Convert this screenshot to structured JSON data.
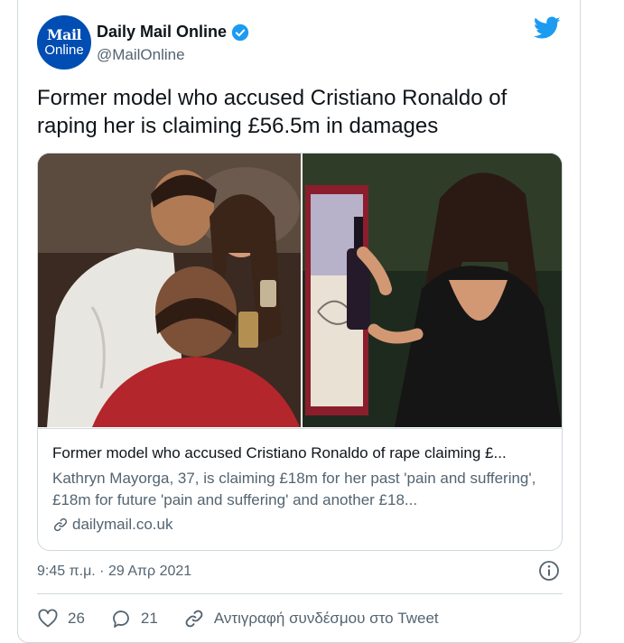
{
  "account": {
    "avatar_line1": "Mail",
    "avatar_line2": "Online",
    "display_name": "Daily Mail Online",
    "handle": "@MailOnline",
    "verified": true
  },
  "tweet": {
    "text": "Former model who accused Cristiano Ronaldo of raping her is claiming £56.5m in damages"
  },
  "card": {
    "title": "Former model who accused Cristiano Ronaldo of rape claiming £...",
    "description": "Kathryn Mayorga, 37, is claiming £18m for her past 'pain and suffering', £18m for future 'pain and suffering' and another £18...",
    "domain": "dailymail.co.uk",
    "media_description": "photo"
  },
  "meta": {
    "timestamp": "9:45 π.μ. · 29 Απρ 2021"
  },
  "actions": {
    "likes": "26",
    "replies": "21",
    "copy_link_label": "Αντιγραφή συνδέσμου στο Tweet"
  },
  "colors": {
    "twitter_blue": "#1d9bf0",
    "avatar_blue": "#004db3",
    "text_primary": "#0f1419",
    "text_secondary": "#536471",
    "border": "#cfd9de"
  },
  "icons": [
    "verified-badge-icon",
    "twitter-bird-icon",
    "link-icon",
    "info-icon",
    "heart-icon",
    "reply-icon",
    "copy-link-icon"
  ]
}
